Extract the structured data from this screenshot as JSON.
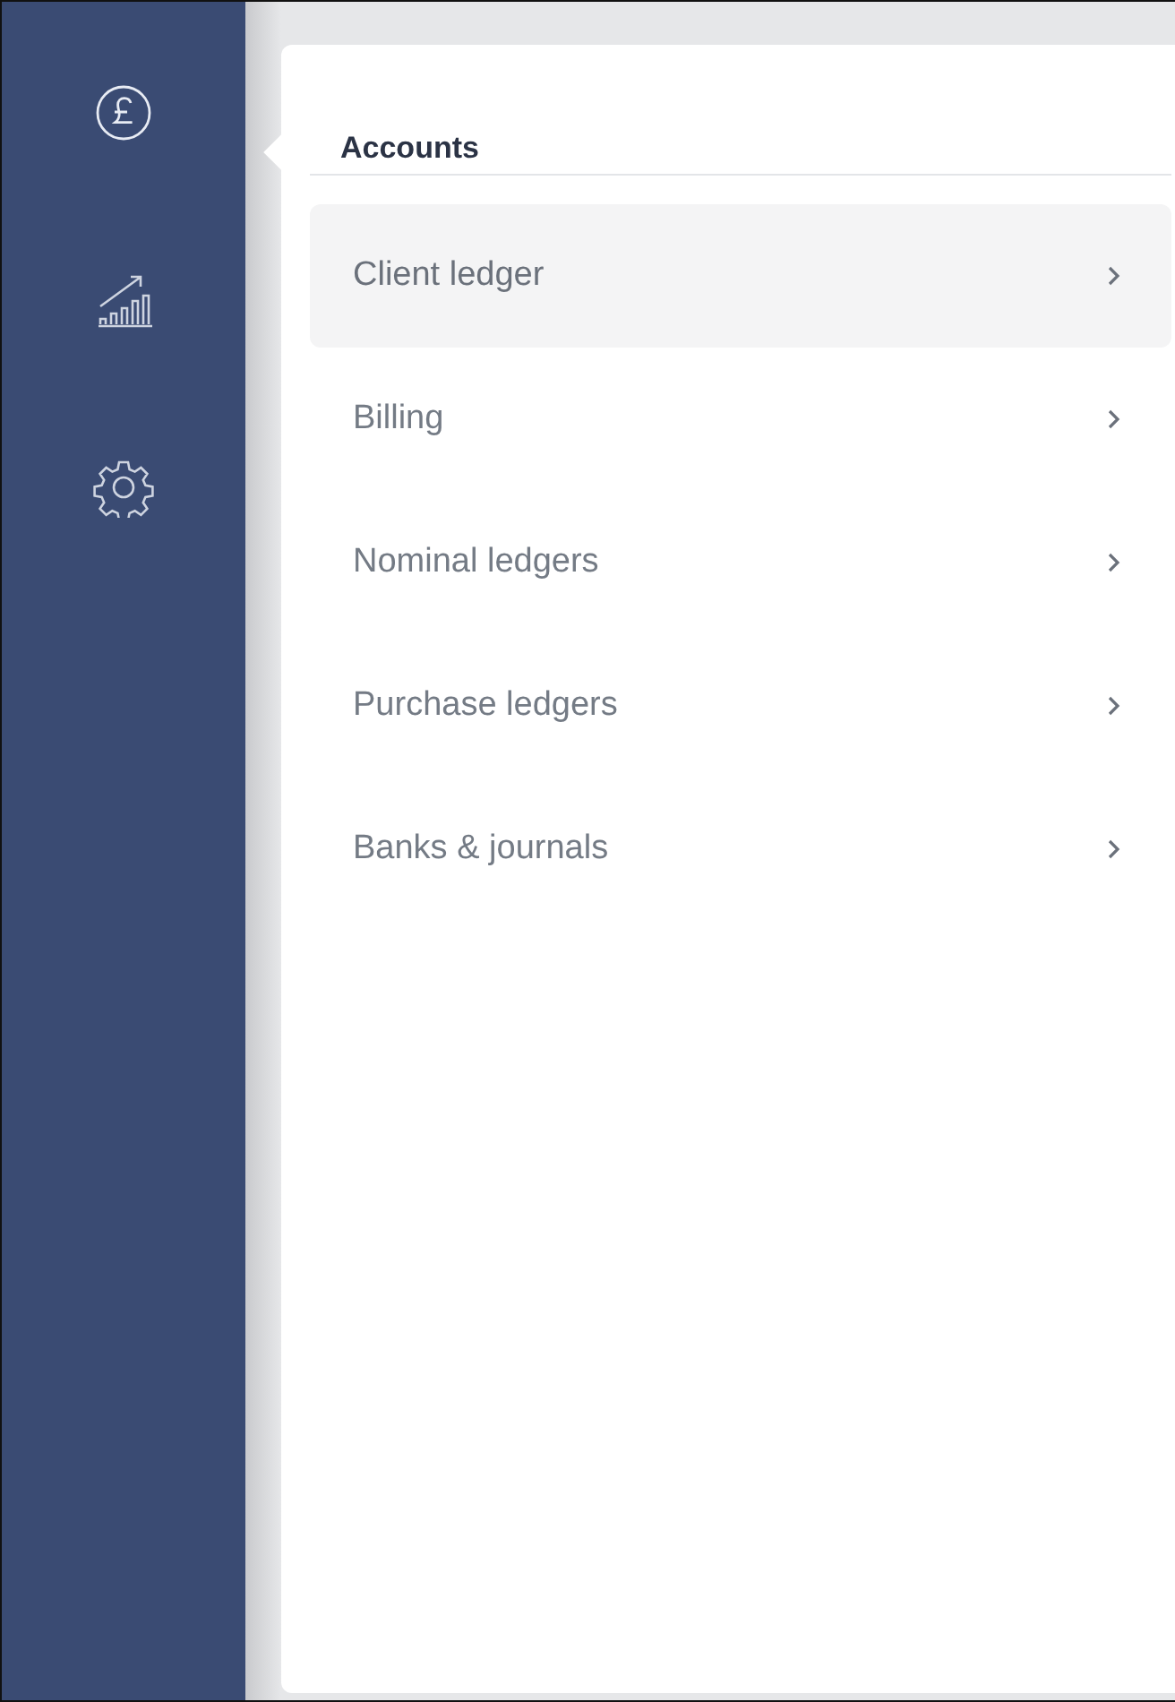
{
  "sidebar": {
    "items": [
      {
        "kind": "pound",
        "selected": true
      },
      {
        "kind": "chart",
        "selected": false
      },
      {
        "kind": "gear",
        "selected": false
      }
    ]
  },
  "panel": {
    "title": "Accounts",
    "items": [
      {
        "label": "Client ledger",
        "selected": true
      },
      {
        "label": "Billing",
        "selected": false
      },
      {
        "label": "Nominal ledgers",
        "selected": false
      },
      {
        "label": "Purchase ledgers",
        "selected": false
      },
      {
        "label": "Banks & journals",
        "selected": false
      }
    ]
  }
}
